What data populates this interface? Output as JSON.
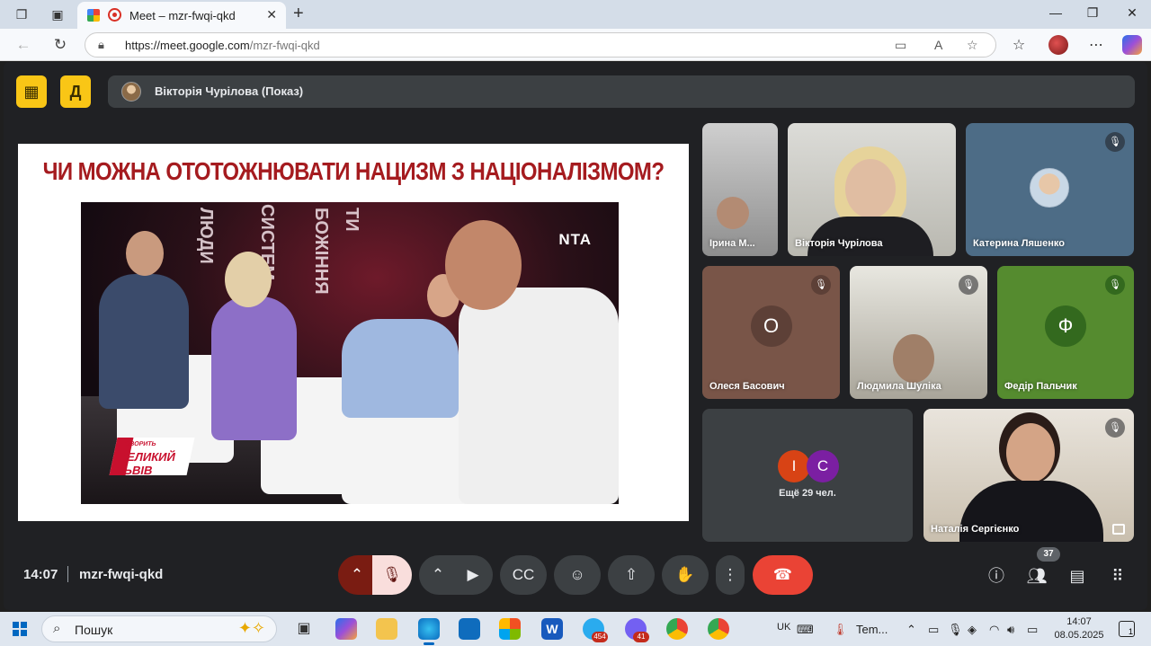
{
  "browser": {
    "tab_title": "Meet – mzr-fwqi-qkd",
    "url_host": "https://meet.google.com",
    "url_path": "/mzr-fwqi-qkd"
  },
  "presenter": {
    "name": "Вікторія Чурілова (Показ)"
  },
  "slide": {
    "title": "ЧИ МОЖНА ОТОТОЖНЮВАТИ НАЦИЗМ З НАЦІОНАЛІЗМОМ?",
    "tv_logo": "NTA",
    "badge_small": "ГОВОРИТЬ",
    "badge_big": "ВЕЛИКИЙ ЛЬВІВ",
    "neon_words": [
      "ЛЮДИ",
      "СИСТЕМ",
      "БОЖІННЯ",
      "ТИ"
    ]
  },
  "participants": [
    {
      "name": "Ірина М...",
      "muted": false
    },
    {
      "name": "Вікторія Чурілова",
      "muted": false
    },
    {
      "name": "Катерина Ляшенко",
      "muted": true
    },
    {
      "name": "Олеся Басович",
      "muted": true,
      "initial": "О",
      "color": "#5d4037"
    },
    {
      "name": "Людмила Шуліка",
      "muted": true
    },
    {
      "name": "Федір Пальчик",
      "muted": true,
      "initial": "Ф",
      "color": "#33691e"
    },
    {
      "name": "Наталія Сергієнко",
      "muted": true
    }
  ],
  "more_participants": {
    "initials": [
      "І",
      "С"
    ],
    "label": "Ещё 29 чел."
  },
  "controls": {
    "time": "14:07",
    "meeting_code": "mzr-fwqi-qkd",
    "participant_count": "37"
  },
  "taskbar": {
    "search_label": "Пошук",
    "telegram_badge": "454",
    "viber_badge": "41",
    "weather_label": "Tem...",
    "lang": "UK",
    "time": "14:07",
    "date": "08.05.2025",
    "notifications": "1"
  },
  "colors": {
    "meet_bg": "#202124",
    "slide_title": "#a51b1f",
    "end_call": "#ea4335",
    "yellow_button": "#f9c616"
  }
}
